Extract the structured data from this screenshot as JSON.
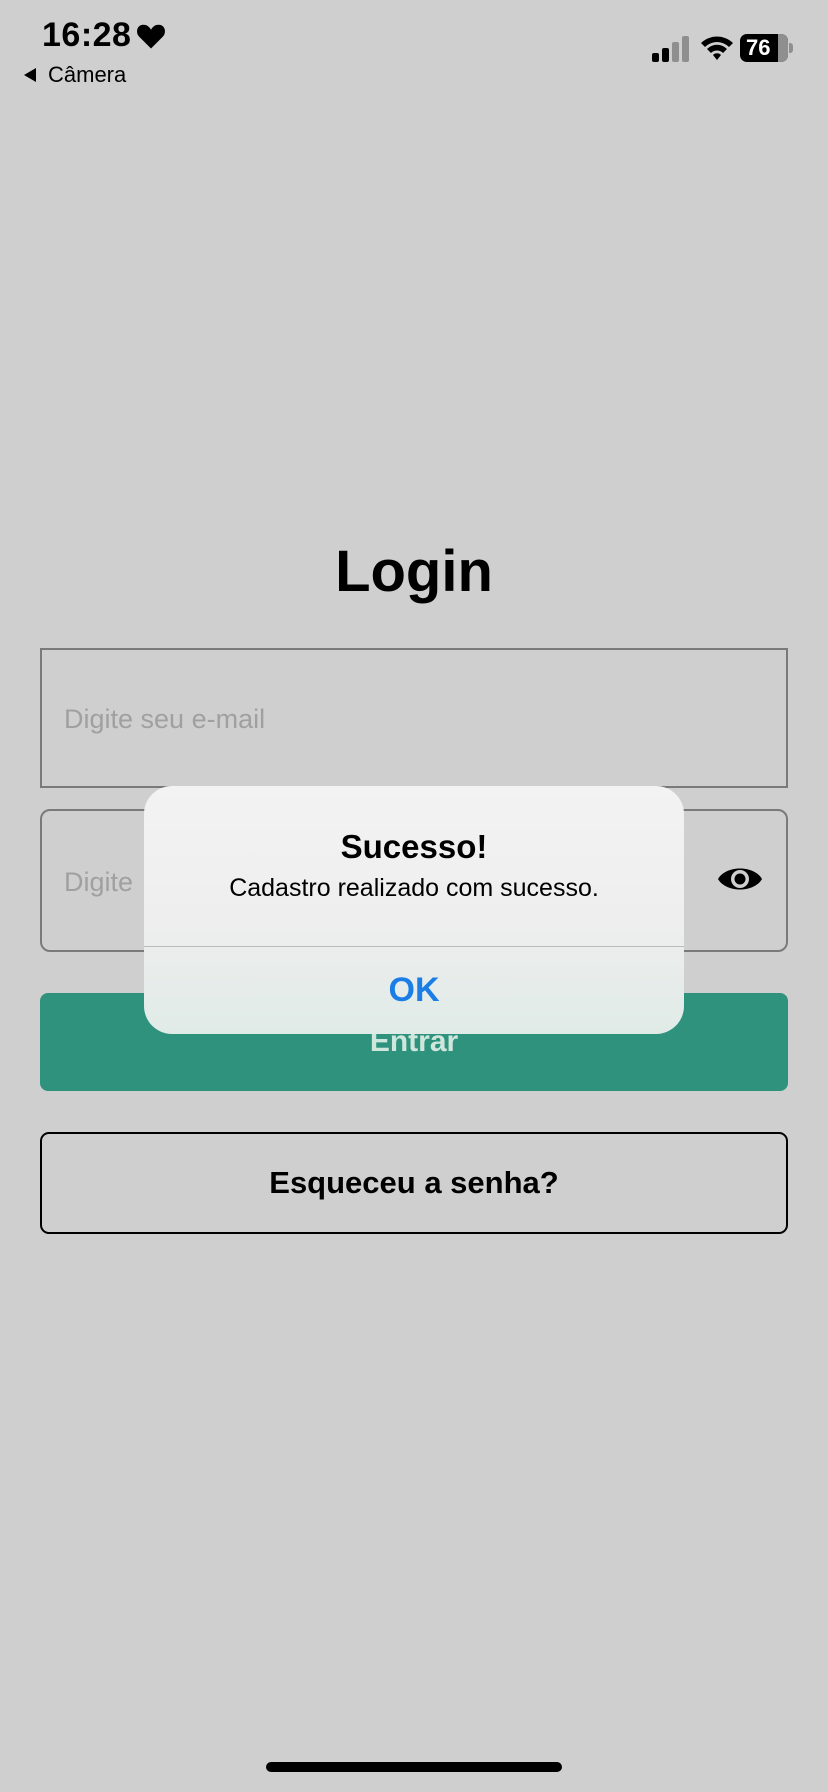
{
  "status_bar": {
    "time": "16:28",
    "back_label": "Câmera",
    "battery": "76"
  },
  "login": {
    "title": "Login",
    "email_placeholder": "Digite seu e-mail",
    "password_placeholder": "Digite",
    "submit_label": "Entrar",
    "forgot_label": "Esqueceu a senha?"
  },
  "alert": {
    "title": "Sucesso!",
    "message": "Cadastro realizado com sucesso.",
    "ok_label": "OK"
  },
  "colors": {
    "background": "#cfcfcf",
    "primary_button": "#2f927d",
    "alert_action": "#1a7ee6"
  }
}
